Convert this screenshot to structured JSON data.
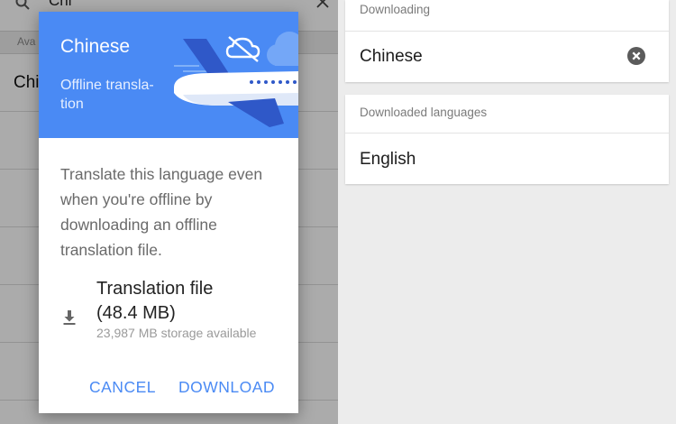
{
  "search": {
    "query": "Chi"
  },
  "available_section": {
    "label": "Ava"
  },
  "language_list": [
    {
      "label": "Chi"
    },
    {
      "label": ""
    },
    {
      "label": ""
    },
    {
      "label": ""
    },
    {
      "label": ""
    },
    {
      "label": ""
    }
  ],
  "dialog": {
    "title": "Chinese",
    "subtitle": "Offline transla-\ntion",
    "body": "Translate this language even when you're offline by downloading an offline translation file.",
    "file_name": "Translation file (48.4 MB)",
    "storage": "23,987 MB storage available",
    "cancel_label": "CANCEL",
    "download_label": "DOWNLOAD"
  },
  "downloading": {
    "label": "Downloading",
    "item": "Chinese"
  },
  "downloaded": {
    "label": "Downloaded languages",
    "item": "English"
  },
  "colors": {
    "accent": "#4a8af4",
    "scrim": "#555555",
    "panel_bg": "#ececec"
  },
  "icons": [
    "search-icon",
    "close-icon",
    "cloud-off-icon",
    "airplane-illustration",
    "download-icon",
    "cancel-circle-icon"
  ]
}
